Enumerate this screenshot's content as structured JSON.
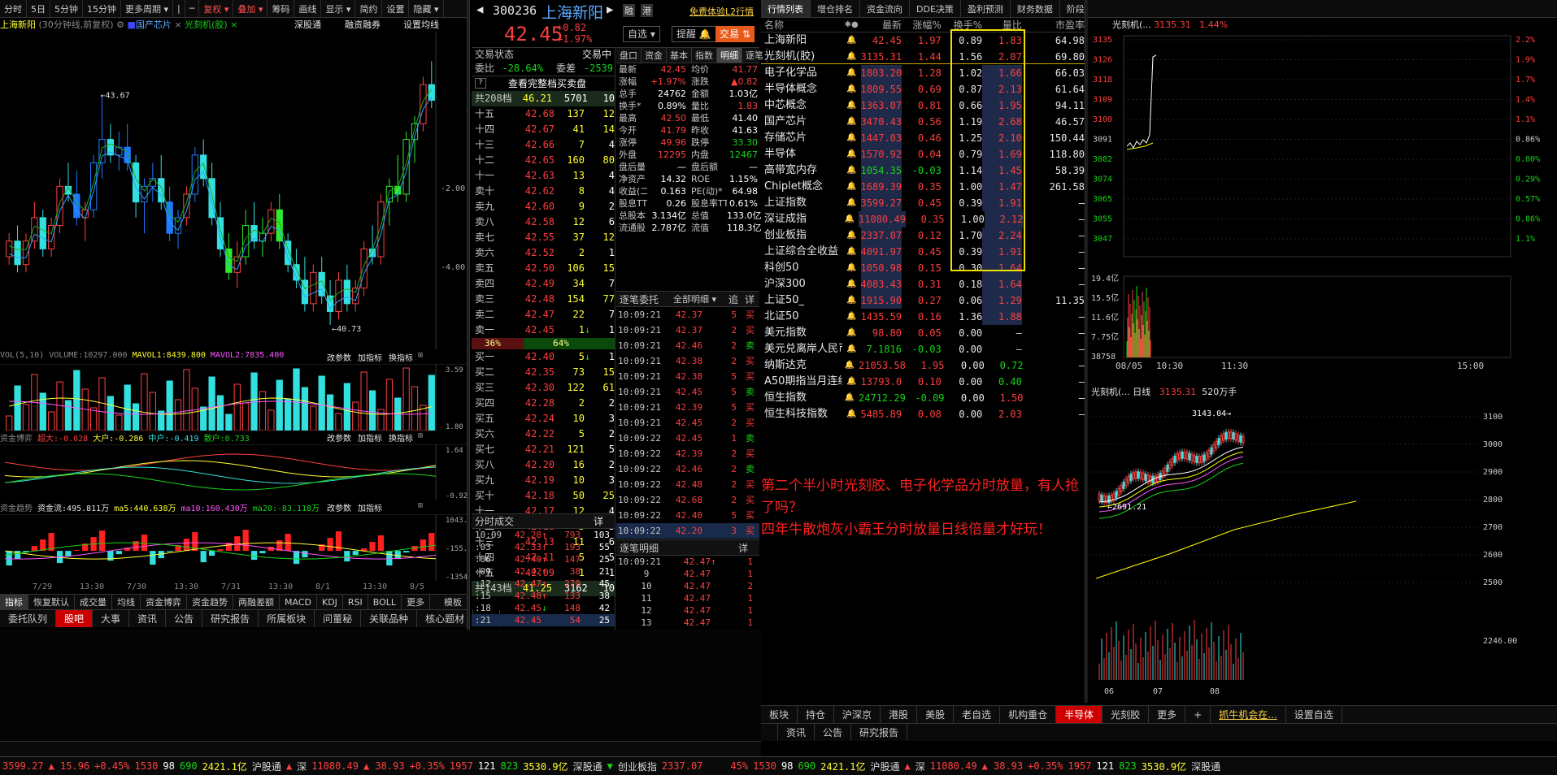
{
  "toolbar": {
    "items": [
      "分时",
      "5日",
      "5分钟",
      "15分钟",
      "更多周期 ▾",
      "|",
      "─",
      "复权 ▾",
      "叠加 ▾",
      "筹码",
      "画线",
      "显示 ▾",
      "简约",
      "设置",
      "隐藏 ▾"
    ]
  },
  "chart": {
    "title": "上海新阳",
    "mode": "(30分钟线,前复权)",
    "overlay1": "国产芯片",
    "overlay2": "光刻机(胶)",
    "right_btns": [
      "深股通",
      "融资融券",
      "设置均线"
    ],
    "high_label": "43.67",
    "low_label": "40.73",
    "yticks": [
      "-2.00",
      "-4.00"
    ]
  },
  "vol": {
    "label": "VOL(5,10) VOLUME:10297.000",
    "ma1": "MAVOL1:8439.800",
    "ma2": "MAVOL2:7835.400",
    "btns": [
      "改参数",
      "加指标",
      "换指标"
    ],
    "yticks": [
      "3.59",
      "1.80"
    ]
  },
  "fund": {
    "label": "资金博弈",
    "super": "超大:-0.028",
    "big": "大户:-0.286",
    "mid": "中户:-0.419",
    "small": "散户:0.733",
    "btns": [
      "改参数",
      "加指标",
      "换指标"
    ],
    "yticks": [
      "1.64",
      "-0.92"
    ]
  },
  "trend": {
    "label": "资金趋势",
    "flow": "资金流:495.811万",
    "ma5": "ma5:440.638万",
    "ma10": "ma10:160.430万",
    "ma20": "ma20:-83.118万",
    "btns": [
      "改参数",
      "加指标"
    ],
    "yticks": [
      "1043.00",
      "-155.00",
      "-1354.00"
    ]
  },
  "dates": [
    "7/29",
    "13:30",
    "7/30",
    "13:30",
    "7/31",
    "13:30",
    "8/1",
    "13:30",
    "8/5"
  ],
  "indtabs": [
    "指标",
    "恢复默认",
    "成交量",
    "均线",
    "资金博弈",
    "资金趋势",
    "两融差额",
    "MACD",
    "KDJ",
    "RSI",
    "BOLL",
    "更多"
  ],
  "indtab_right": "模板",
  "bottomtabs": [
    "委托队列",
    "股吧",
    "大事",
    "资讯",
    "公告",
    "研究报告",
    "所属板块",
    "问董秘",
    "关联品种",
    "核心题材",
    "租"
  ],
  "stock": {
    "code": "300236",
    "name": "上海新阳",
    "tag1": "融",
    "tag2": "港",
    "l2": "免费体验L2行情",
    "price": "42.45",
    "chg": "+0.82",
    "pct": "+1.97%",
    "btn_zixuan": "自选",
    "btn_tixing": "提醒",
    "btn_trade": "交易"
  },
  "ob": {
    "status_label": "交易状态",
    "status": "交易中",
    "wb_label": "委比",
    "wb": "-28.64%",
    "wc_label": "委差",
    "wc": "-2539",
    "full_btn": "查看完整档买卖盘",
    "sell_sum": {
      "label": "共208档",
      "price": "46.21",
      "vol": "5701",
      "n": "10"
    },
    "asks": [
      [
        "十五",
        "42.68",
        "137",
        "12"
      ],
      [
        "十四",
        "42.67",
        "41",
        "14"
      ],
      [
        "十三",
        "42.66",
        "7",
        "4"
      ],
      [
        "十二",
        "42.65",
        "160",
        "80"
      ],
      [
        "十一",
        "42.63",
        "13",
        "4"
      ],
      [
        "卖十",
        "42.62",
        "8",
        "4"
      ],
      [
        "卖九",
        "42.60",
        "9",
        "2"
      ],
      [
        "卖八",
        "42.58",
        "12",
        "6"
      ],
      [
        "卖七",
        "42.55",
        "37",
        "12"
      ],
      [
        "卖六",
        "42.52",
        "2",
        "1"
      ],
      [
        "卖五",
        "42.50",
        "106",
        "15"
      ],
      [
        "卖四",
        "42.49",
        "34",
        "7"
      ],
      [
        "卖三",
        "42.48",
        "154",
        "77"
      ],
      [
        "卖二",
        "42.47",
        "22",
        "7"
      ],
      [
        "卖一",
        "42.45",
        "1",
        "1"
      ]
    ],
    "ratio_sell": "36%",
    "ratio_buy": "64%",
    "bids": [
      [
        "买一",
        "42.40",
        "5",
        "1"
      ],
      [
        "买二",
        "42.35",
        "73",
        "15"
      ],
      [
        "买三",
        "42.30",
        "122",
        "61"
      ],
      [
        "买四",
        "42.28",
        "2",
        "2"
      ],
      [
        "买五",
        "42.24",
        "10",
        "3"
      ],
      [
        "买六",
        "42.22",
        "5",
        "2"
      ],
      [
        "买七",
        "42.21",
        "121",
        "5"
      ],
      [
        "买八",
        "42.20",
        "16",
        "2"
      ],
      [
        "买九",
        "42.19",
        "10",
        "3"
      ],
      [
        "买十",
        "42.18",
        "50",
        "25"
      ],
      [
        "十一",
        "42.17",
        "12",
        "4"
      ],
      [
        "十二",
        "42.16",
        "5",
        "5"
      ],
      [
        "十三",
        "42.13",
        "11",
        "6"
      ],
      [
        "十四",
        "42.11",
        "5",
        "5"
      ],
      [
        "十五",
        "42.09",
        "1",
        "1"
      ]
    ],
    "buy_sum": {
      "label": "共143档",
      "price": "41.25",
      "vol": "3162",
      "n": "10"
    }
  },
  "ticks": {
    "title": "分时成交",
    "btn": "详",
    "rows": [
      [
        "10:09",
        "42.28",
        "↑",
        "793",
        "103"
      ],
      [
        ":03",
        "42.33",
        "↑",
        "193",
        "55"
      ],
      [
        ":06",
        "42.40",
        "↑",
        "147",
        "25"
      ],
      [
        ":09",
        "42.42",
        "↑",
        "38",
        "21"
      ],
      [
        ":12",
        "42.47",
        "↑",
        "270",
        "45"
      ],
      [
        ":15",
        "42.48",
        "↑",
        "133",
        "38"
      ],
      [
        ":18",
        "42.45",
        "↓",
        "148",
        "42"
      ],
      [
        ":21",
        "42.45",
        "",
        "54",
        "25"
      ]
    ]
  },
  "stats": {
    "tabs": [
      "盘口",
      "资金",
      "基本",
      "指数",
      "明细",
      "逐笔"
    ],
    "rows": [
      [
        "最新",
        "42.45",
        "均价",
        "41.77"
      ],
      [
        "涨幅",
        "+1.97%",
        "涨跌",
        "▲0.82"
      ],
      [
        "总手",
        "24762",
        "金额",
        "1.03亿"
      ],
      [
        "换手*",
        "0.89%",
        "量比",
        "1.83"
      ],
      [
        "最高",
        "42.50",
        "最低",
        "41.40"
      ],
      [
        "今开",
        "41.79",
        "昨收",
        "41.63"
      ],
      [
        "涨停",
        "49.96",
        "跌停",
        "33.30"
      ],
      [
        "外盘",
        "12295",
        "内盘",
        "12467"
      ],
      [
        "盘后量",
        "—",
        "盘后额",
        "—"
      ],
      [
        "净资产",
        "14.32",
        "ROE",
        "1.15%"
      ],
      [
        "收益(二)",
        "0.163",
        "PE(动)*",
        "64.98"
      ],
      [
        "股息TTM",
        "0.26",
        "股息率TTM",
        "0.61%"
      ],
      [
        "总股本",
        "3.134亿",
        "总值",
        "133.0亿"
      ],
      [
        "流通股",
        "2.787亿",
        "流值",
        "118.3亿"
      ]
    ]
  },
  "zbwt": {
    "title": "逐笔委托",
    "filter": "全部明细",
    "b1": "追",
    "b2": "详",
    "rows": [
      [
        "10:09:21",
        "42.37",
        "5",
        "买"
      ],
      [
        "10:09:21",
        "42.37",
        "2",
        "买"
      ],
      [
        "10:09:21",
        "42.46",
        "2",
        "卖"
      ],
      [
        "10:09:21",
        "42.38",
        "2",
        "买"
      ],
      [
        "10:09:21",
        "42.38",
        "5",
        "买"
      ],
      [
        "10:09:21",
        "42.45",
        "5",
        "卖"
      ],
      [
        "10:09:21",
        "42.39",
        "5",
        "买"
      ],
      [
        "10:09:21",
        "42.45",
        "2",
        "买"
      ],
      [
        "10:09:22",
        "42.45",
        "1",
        "卖"
      ],
      [
        "10:09:22",
        "42.39",
        "2",
        "买"
      ],
      [
        "10:09:22",
        "42.46",
        "2",
        "卖"
      ],
      [
        "10:09:22",
        "42.48",
        "2",
        "买"
      ],
      [
        "10:09:22",
        "42.68",
        "2",
        "买"
      ],
      [
        "10:09:22",
        "42.40",
        "5",
        "买"
      ],
      [
        "10:09:22",
        "42.20",
        "3",
        "买"
      ]
    ]
  },
  "zbmx": {
    "title": "逐笔明细",
    "btn": "详",
    "rows": [
      [
        "10:09:21",
        "42.47",
        "↑",
        "1"
      ],
      [
        "9",
        "42.47",
        "",
        "1"
      ],
      [
        "10",
        "42.47",
        "",
        "2"
      ],
      [
        "11",
        "42.47",
        "",
        "1"
      ],
      [
        "12",
        "42.47",
        "",
        "1"
      ],
      [
        "13",
        "42.47",
        "",
        "1"
      ],
      [
        "14",
        "42.40",
        "↓",
        "1"
      ],
      [
        "15",
        "42.40",
        "",
        "1"
      ],
      [
        "16",
        "42.40",
        "",
        "1"
      ],
      [
        "17",
        "42.40",
        "",
        "1"
      ],
      [
        "18",
        "42.40",
        "",
        "2"
      ],
      [
        "10:09:22",
        "42.45",
        "↑",
        "1"
      ],
      [
        "2",
        "42.45",
        "",
        "1"
      ],
      [
        "3",
        "42.45",
        "",
        "2"
      ]
    ]
  },
  "market": {
    "tabs": [
      "行情列表",
      "增仓排名",
      "资金流向",
      "DDE决策",
      "盈利预测",
      "财务数据",
      "阶段统计",
      "多股同列"
    ],
    "headers": [
      "名称",
      "最新",
      "涨幅%",
      "换手%",
      "量比",
      "市盈率"
    ],
    "rows": [
      [
        "上海新阳",
        "42.45",
        "1.97",
        "0.89",
        "1.83",
        "64.98"
      ],
      [
        "光刻机(胶)",
        "3135.31",
        "1.44",
        "1.56",
        "2.07",
        "69.80"
      ],
      [
        "电子化学品",
        "1803.20",
        "1.28",
        "1.02",
        "1.66",
        "66.03"
      ],
      [
        "半导体概念",
        "1809.55",
        "0.69",
        "0.87",
        "2.13",
        "61.64"
      ],
      [
        "中芯概念",
        "1363.07",
        "0.81",
        "0.66",
        "1.95",
        "94.11"
      ],
      [
        "国产芯片",
        "3470.43",
        "0.56",
        "1.19",
        "2.68",
        "46.57"
      ],
      [
        "存储芯片",
        "1447.03",
        "0.46",
        "1.25",
        "2.10",
        "150.44"
      ],
      [
        "半导体",
        "1570.92",
        "0.04",
        "0.79",
        "1.69",
        "118.80"
      ],
      [
        "高带宽内存",
        "1054.35",
        "-0.03",
        "1.14",
        "1.45",
        "58.39"
      ],
      [
        "Chiplet概念",
        "1689.39",
        "0.35",
        "1.00",
        "1.47",
        "261.58"
      ],
      [
        "上证指数",
        "3599.27",
        "0.45",
        "0.39",
        "1.91",
        "—"
      ],
      [
        "深证成指",
        "11080.49",
        "0.35",
        "1.00",
        "2.12",
        "—"
      ],
      [
        "创业板指",
        "2337.07",
        "0.12",
        "1.70",
        "2.24",
        "—"
      ],
      [
        "上证综合全收益",
        "4091.97",
        "0.45",
        "0.39",
        "1.91",
        "—"
      ],
      [
        "科创50",
        "1050.98",
        "0.15",
        "0.30",
        "1.64",
        "—"
      ],
      [
        "沪深300",
        "4083.43",
        "0.31",
        "0.18",
        "1.64",
        "—"
      ],
      [
        "上证50_",
        "1915.90",
        "0.27",
        "0.06",
        "1.29",
        "11.35"
      ],
      [
        "北证50",
        "1435.59",
        "0.16",
        "1.36",
        "1.88",
        "—"
      ],
      [
        "美元指数",
        "98.80",
        "0.05",
        "0.00",
        "—",
        "—"
      ],
      [
        "美元兑离岸人民币",
        "7.1816",
        "-0.03",
        "0.00",
        "—",
        "—"
      ],
      [
        "纳斯达克",
        "21053.58",
        "1.95",
        "0.00",
        "0.72",
        "—"
      ],
      [
        "A50期指当月连续",
        "13793.0",
        "0.10",
        "0.00",
        "0.40",
        "—"
      ],
      [
        "恒生指数",
        "24712.29",
        "-0.09",
        "0.00",
        "1.50",
        "—"
      ],
      [
        "恒生科技指数",
        "5485.89",
        "0.08",
        "0.00",
        "2.03",
        "—"
      ]
    ]
  },
  "note": [
    "第二个半小时光刻胶、电子化学品分时放量，有人抢了吗？",
    "四年牛散炮灰小霸王分时放量日线倍量才好玩！"
  ],
  "mtabs": [
    "板块",
    "持仓",
    "沪深京",
    "港股",
    "美股",
    "老自选",
    "机构重仓",
    "半导体",
    "光刻胶",
    "更多",
    "+",
    "抓牛机会在...",
    "设置自选"
  ],
  "subtabs": [
    "资讯",
    "公告",
    "研究报告"
  ],
  "mini1": {
    "name": "光刻机(...",
    "price": "3135.31",
    "pct": "1.44%",
    "yl": [
      "3135",
      "3126",
      "3118",
      "3109",
      "3100",
      "3091",
      "3082",
      "3074",
      "3065",
      "3055",
      "3047"
    ],
    "yr": [
      "2.2%",
      "1.9%",
      "1.7%",
      "1.4%",
      "1.1%",
      "0.86%",
      "0.00%",
      "0.29%",
      "0.57%",
      "0.86%",
      "1.1%",
      "1.4%"
    ],
    "vl": [
      "19.4亿",
      "15.5亿",
      "11.6亿",
      "7.75亿",
      "38758"
    ],
    "times": [
      "08/05",
      "10:30",
      "11:30",
      "15:00"
    ]
  },
  "mini2": {
    "name": "光刻机(...",
    "period": "日线",
    "price": "3135.31",
    "vol": "520万手",
    "hi": "3143.04",
    "lo": "2691.21",
    "yr": [
      "3100",
      "3000",
      "2900",
      "2800",
      "2700",
      "2600",
      "2500",
      "2246.00"
    ],
    "months": [
      "06",
      "07",
      "08"
    ]
  },
  "status": {
    "items": [
      "3599.27",
      "▲ 15.96",
      "+0.45%",
      "1530",
      "98",
      "690",
      "2421.1亿",
      "沪股通",
      "▲",
      "深",
      "11080.49",
      "▲ 38.93",
      "+0.35%",
      "1957",
      "121",
      "823",
      "3530.9亿",
      "深股通",
      "▼",
      "创业板指",
      "2337.07"
    ],
    "right": [
      "45%",
      "1530",
      "98",
      "690",
      "2421.1亿",
      "沪股通",
      "▲",
      "深",
      "11080.49",
      "▲ 38.93",
      "+0.35%",
      "1957",
      "121",
      "823",
      "3530.9亿",
      "深股通"
    ]
  },
  "candles": [
    [
      41.6,
      41.9,
      41.5,
      41.8
    ],
    [
      41.8,
      42.0,
      41.4,
      41.5
    ],
    [
      41.5,
      41.9,
      41.4,
      41.8
    ],
    [
      41.8,
      42.3,
      41.7,
      42.1
    ],
    [
      42.1,
      42.2,
      41.6,
      41.7
    ],
    [
      41.7,
      42.1,
      41.6,
      42.0
    ],
    [
      42.0,
      42.6,
      41.9,
      42.5
    ],
    [
      42.5,
      42.8,
      42.3,
      42.4
    ],
    [
      42.4,
      42.7,
      42.0,
      42.1
    ],
    [
      42.1,
      42.3,
      41.8,
      42.2
    ],
    [
      42.2,
      42.9,
      42.1,
      42.8
    ],
    [
      42.8,
      43.67,
      42.6,
      43.1
    ],
    [
      43.1,
      43.3,
      42.8,
      42.9
    ],
    [
      42.9,
      43.2,
      42.7,
      43.0
    ],
    [
      43.0,
      43.3,
      42.7,
      42.8
    ],
    [
      42.8,
      42.9,
      42.1,
      42.3
    ],
    [
      42.3,
      42.6,
      41.9,
      42.5
    ],
    [
      42.5,
      42.8,
      42.3,
      42.6
    ],
    [
      42.6,
      42.9,
      42.2,
      42.3
    ],
    [
      42.3,
      42.5,
      41.8,
      41.9
    ],
    [
      41.9,
      42.2,
      41.7,
      42.1
    ],
    [
      42.1,
      42.5,
      42.0,
      42.4
    ],
    [
      42.4,
      43.0,
      42.3,
      42.9
    ],
    [
      42.9,
      43.1,
      42.5,
      42.6
    ],
    [
      42.6,
      42.8,
      42.0,
      42.1
    ],
    [
      42.1,
      42.3,
      41.6,
      41.7
    ],
    [
      41.7,
      41.9,
      41.3,
      41.4
    ],
    [
      41.4,
      41.8,
      41.2,
      41.6
    ],
    [
      41.6,
      42.2,
      41.5,
      42.0
    ],
    [
      42.0,
      42.3,
      41.7,
      41.8
    ],
    [
      41.8,
      42.1,
      41.6,
      41.9
    ],
    [
      41.9,
      42.3,
      41.8,
      42.2
    ],
    [
      42.2,
      42.4,
      41.7,
      41.8
    ],
    [
      41.8,
      41.9,
      41.4,
      41.5
    ],
    [
      41.5,
      41.7,
      41.2,
      41.3
    ],
    [
      41.3,
      41.6,
      40.9,
      41.0
    ],
    [
      41.0,
      41.5,
      40.9,
      41.4
    ],
    [
      41.4,
      41.6,
      41.0,
      41.1
    ],
    [
      41.1,
      41.3,
      40.73,
      40.9
    ],
    [
      40.9,
      41.4,
      40.8,
      41.3
    ],
    [
      41.3,
      41.5,
      40.9,
      41.0
    ],
    [
      41.0,
      41.3,
      40.9,
      41.2
    ],
    [
      41.2,
      41.8,
      41.1,
      41.7
    ],
    [
      41.7,
      42.0,
      41.5,
      41.6
    ],
    [
      41.6,
      42.4,
      41.5,
      42.3
    ],
    [
      42.3,
      42.6,
      42.0,
      42.5
    ],
    [
      42.5,
      42.9,
      42.3,
      42.4
    ],
    [
      42.4,
      43.2,
      42.3,
      43.1
    ],
    [
      43.1,
      43.4,
      42.8,
      43.3
    ],
    [
      43.3,
      43.9,
      43.2,
      43.8
    ],
    [
      43.8,
      44.1,
      43.5,
      43.6
    ]
  ]
}
